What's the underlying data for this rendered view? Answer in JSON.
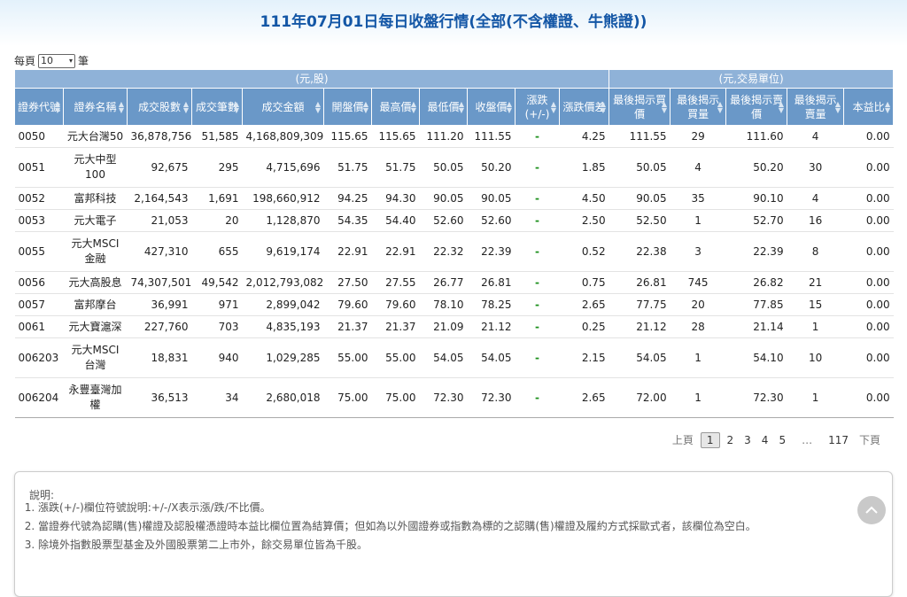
{
  "title": {
    "year": "111",
    "year_unit": "年",
    "month": "07",
    "month_unit": "月",
    "day": "01",
    "day_unit": "日每日收盤行情",
    "scope": "(全部(不含權證、牛熊證))"
  },
  "per_page": {
    "prefix": "每頁",
    "value": "10",
    "suffix": "筆"
  },
  "unit_headers": {
    "left": "(元,股)",
    "right": "(元,交易單位)"
  },
  "columns": [
    "證券代號",
    "證券名稱",
    "成交股數",
    "成交筆數",
    "成交金額",
    "開盤價",
    "最高價",
    "最低價",
    "收盤價",
    "漲跌(+/-)",
    "漲跌價差",
    "最後揭示買價",
    "最後揭示買量",
    "最後揭示賣價",
    "最後揭示賣量",
    "本益比"
  ],
  "rows": [
    {
      "code": "0050",
      "name": "元大台灣50",
      "volume": "36,878,756",
      "trades": "51,585",
      "value": "4,168,809,309",
      "open": "115.65",
      "high": "115.65",
      "low": "111.20",
      "close": "111.55",
      "sign": "-",
      "change": "4.25",
      "bid": "111.55",
      "bid_vol": "29",
      "ask": "111.60",
      "ask_vol": "4",
      "pe": "0.00"
    },
    {
      "code": "0051",
      "name": "元大中型100",
      "volume": "92,675",
      "trades": "295",
      "value": "4,715,696",
      "open": "51.75",
      "high": "51.75",
      "low": "50.05",
      "close": "50.20",
      "sign": "-",
      "change": "1.85",
      "bid": "50.05",
      "bid_vol": "4",
      "ask": "50.20",
      "ask_vol": "30",
      "pe": "0.00"
    },
    {
      "code": "0052",
      "name": "富邦科技",
      "volume": "2,164,543",
      "trades": "1,691",
      "value": "198,660,912",
      "open": "94.25",
      "high": "94.30",
      "low": "90.05",
      "close": "90.05",
      "sign": "-",
      "change": "4.50",
      "bid": "90.05",
      "bid_vol": "35",
      "ask": "90.10",
      "ask_vol": "4",
      "pe": "0.00"
    },
    {
      "code": "0053",
      "name": "元大電子",
      "volume": "21,053",
      "trades": "20",
      "value": "1,128,870",
      "open": "54.35",
      "high": "54.40",
      "low": "52.60",
      "close": "52.60",
      "sign": "-",
      "change": "2.50",
      "bid": "52.50",
      "bid_vol": "1",
      "ask": "52.70",
      "ask_vol": "16",
      "pe": "0.00"
    },
    {
      "code": "0055",
      "name": "元大MSCI金融",
      "volume": "427,310",
      "trades": "655",
      "value": "9,619,174",
      "open": "22.91",
      "high": "22.91",
      "low": "22.32",
      "close": "22.39",
      "sign": "-",
      "change": "0.52",
      "bid": "22.38",
      "bid_vol": "3",
      "ask": "22.39",
      "ask_vol": "8",
      "pe": "0.00"
    },
    {
      "code": "0056",
      "name": "元大高股息",
      "volume": "74,307,501",
      "trades": "49,542",
      "value": "2,012,793,082",
      "open": "27.50",
      "high": "27.55",
      "low": "26.77",
      "close": "26.81",
      "sign": "-",
      "change": "0.75",
      "bid": "26.81",
      "bid_vol": "745",
      "ask": "26.82",
      "ask_vol": "21",
      "pe": "0.00"
    },
    {
      "code": "0057",
      "name": "富邦摩台",
      "volume": "36,991",
      "trades": "971",
      "value": "2,899,042",
      "open": "79.60",
      "high": "79.60",
      "low": "78.10",
      "close": "78.25",
      "sign": "-",
      "change": "2.65",
      "bid": "77.75",
      "bid_vol": "20",
      "ask": "77.85",
      "ask_vol": "15",
      "pe": "0.00"
    },
    {
      "code": "0061",
      "name": "元大寶滬深",
      "volume": "227,760",
      "trades": "703",
      "value": "4,835,193",
      "open": "21.37",
      "high": "21.37",
      "low": "21.09",
      "close": "21.12",
      "sign": "-",
      "change": "0.25",
      "bid": "21.12",
      "bid_vol": "28",
      "ask": "21.14",
      "ask_vol": "1",
      "pe": "0.00"
    },
    {
      "code": "006203",
      "name": "元大MSCI台灣",
      "volume": "18,831",
      "trades": "940",
      "value": "1,029,285",
      "open": "55.00",
      "high": "55.00",
      "low": "54.05",
      "close": "54.05",
      "sign": "-",
      "change": "2.15",
      "bid": "54.05",
      "bid_vol": "1",
      "ask": "54.10",
      "ask_vol": "10",
      "pe": "0.00"
    },
    {
      "code": "006204",
      "name": "永豐臺灣加權",
      "volume": "36,513",
      "trades": "34",
      "value": "2,680,018",
      "open": "75.00",
      "high": "75.00",
      "low": "72.30",
      "close": "72.30",
      "sign": "-",
      "change": "2.65",
      "bid": "72.00",
      "bid_vol": "1",
      "ask": "72.30",
      "ask_vol": "1",
      "pe": "0.00"
    }
  ],
  "pagination": {
    "prev": "上頁",
    "pages": [
      "1",
      "2",
      "3",
      "4",
      "5"
    ],
    "current": "1",
    "ellipsis": "…",
    "last": "117",
    "next": "下頁"
  },
  "notes": {
    "label": "說明:",
    "items": [
      "漲跌(+/-)欄位符號說明:+/-/X表示漲/跌/不比價。",
      "當證券代號為認購(售)權證及認股權憑證時本益比欄位置為結算價；但如為以外國證券或指數為標的之認購(售)權證及履約方式採歐式者，該欄位為空白。",
      "除境外指數股票型基金及外國股票第二上市外，餘交易單位皆為千股。"
    ]
  },
  "colors": {
    "header_bg": "#6a98c8",
    "title": "#1457a6",
    "change_sign": "#1b8f1b"
  },
  "icons": {
    "back_to_top": "chevron-up-icon",
    "sort": "sort-icon",
    "select_arrow": "chevron-down-icon"
  }
}
